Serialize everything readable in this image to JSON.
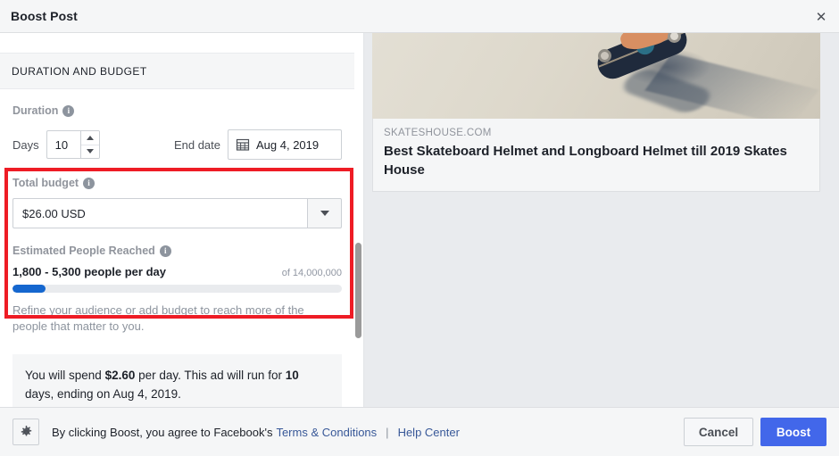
{
  "window": {
    "title": "Boost Post",
    "close_icon": "close-icon"
  },
  "section": {
    "header": "DURATION AND BUDGET"
  },
  "duration": {
    "label": "Duration",
    "info_icon": "info-icon",
    "days_label": "Days",
    "days_value": "10",
    "stepper_up_icon": "chevron-up-icon",
    "stepper_down_icon": "chevron-down-icon",
    "end_date_label": "End date",
    "calendar_icon": "calendar-icon",
    "end_date_value": "Aug 4, 2019"
  },
  "budget": {
    "label": "Total budget",
    "info_icon": "info-icon",
    "value": "$26.00 USD",
    "placeholder": "$26.00 USD",
    "dropdown_icon": "caret-down-icon"
  },
  "reach": {
    "label": "Estimated People Reached",
    "info_icon": "info-icon",
    "range_text": "1,800 - 5,300 people per day",
    "of_text": "of 14,000,000",
    "progress_percent": 10,
    "progress_color": "#1567cf",
    "note": "Refine your audience or add budget to reach more of the people that matter to you."
  },
  "spend_summary": {
    "part1": "You will spend ",
    "amount": "$2.60",
    "part2": " per day. This ad will run for ",
    "days": "10",
    "part3": " days, ending on Aug 4, 2019."
  },
  "highlight": {
    "color": "#ee1c25"
  },
  "preview": {
    "image_alt": "skateboard-photo",
    "domain": "SKATESHOUSE.COM",
    "title": "Best Skateboard Helmet and Longboard Helmet till 2019 Skates House"
  },
  "footer": {
    "gear_icon": "gear-icon",
    "text_before": "By clicking Boost, you agree to Facebook's",
    "terms_link": "Terms & Conditions",
    "separator": "|",
    "help_link": "Help Center",
    "cancel_label": "Cancel",
    "boost_label": "Boost",
    "boost_color": "#4267ea"
  }
}
